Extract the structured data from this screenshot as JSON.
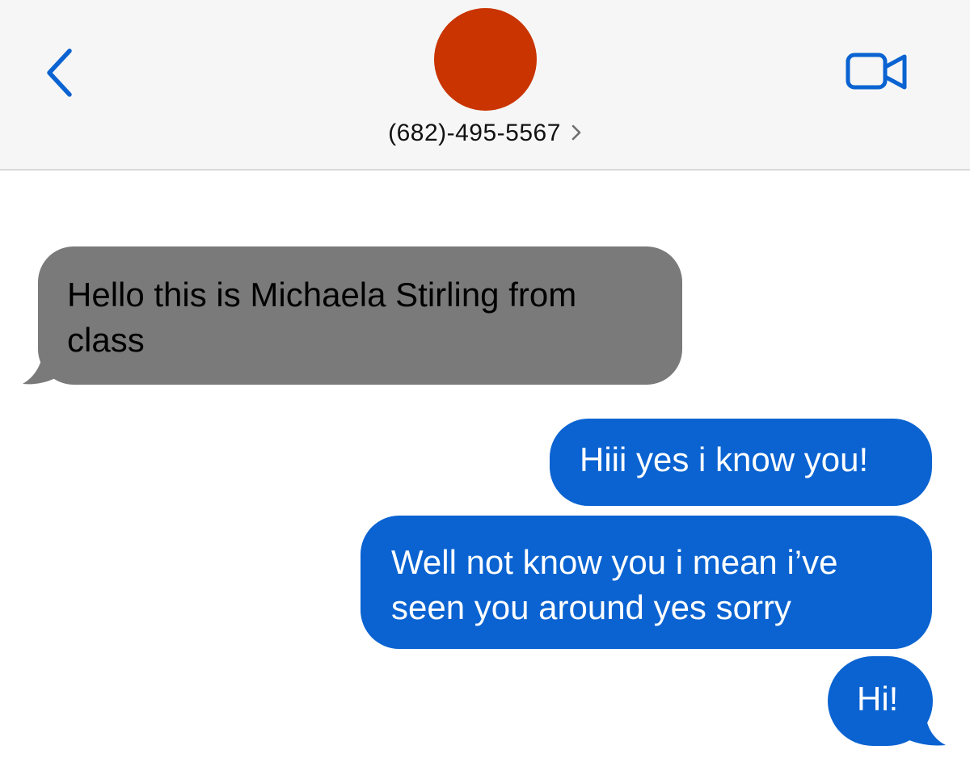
{
  "header": {
    "back_icon": "chevron-left-icon",
    "avatar_color": "#c93400",
    "contact_name": "(682)-495-5567",
    "contact_chevron_icon": "chevron-right-icon",
    "video_icon": "video-camera-icon",
    "accent_color": "#0a63d1"
  },
  "messages": [
    {
      "direction": "incoming",
      "line1": "Hello this is Michaela Stirling from",
      "line2": "class",
      "bubble_color": "#7a7a7a"
    },
    {
      "direction": "outgoing",
      "line1": "Hiii yes i know you!",
      "bubble_color": "#0a63d1"
    },
    {
      "direction": "outgoing",
      "line1": "Well not know you i mean i’ve",
      "line2": "seen you around yes  sorry",
      "bubble_color": "#0a63d1"
    },
    {
      "direction": "outgoing",
      "line1": "Hi!",
      "bubble_color": "#0a63d1"
    }
  ]
}
